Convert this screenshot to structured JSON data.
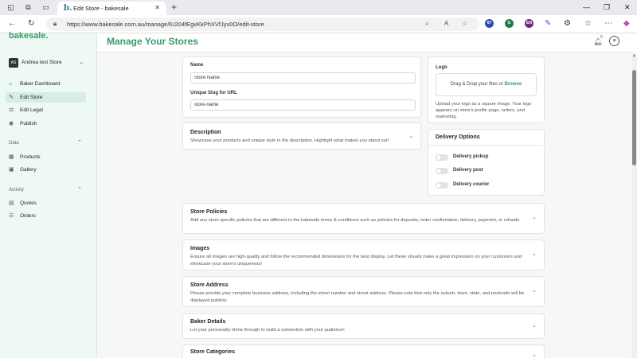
{
  "browser": {
    "tab_title": "Edit Store - bakesale",
    "tab_favicon": "b.",
    "url": "https://www.bakesale.com.au/manage/lU204fEgvKkPhXVfJyv0O/edit-store",
    "extensions": [
      "67",
      "G",
      "EN"
    ]
  },
  "sidebar": {
    "logo": "bakesale.",
    "store_avatar": "AS",
    "store_name": "Andrea test Store",
    "items": [
      {
        "label": "Baker Dashboard",
        "icon": "home-icon"
      },
      {
        "label": "Edit Store",
        "icon": "edit-icon"
      },
      {
        "label": "Edit Legal",
        "icon": "legal-icon"
      },
      {
        "label": "Publish",
        "icon": "eye-icon"
      }
    ],
    "data_section": "Data",
    "data_items": [
      {
        "label": "Products",
        "icon": "box-icon"
      },
      {
        "label": "Gallery",
        "icon": "image-icon"
      }
    ],
    "activity_section": "Activity",
    "activity_items": [
      {
        "label": "Quotes",
        "icon": "document-icon"
      },
      {
        "label": "Orders",
        "icon": "list-icon"
      }
    ]
  },
  "header": {
    "title": "Manage Your Stores",
    "bell_badge": "0"
  },
  "form": {
    "name_label": "Name",
    "name_value": "Store Name",
    "slug_label": "Unique Slug for URL",
    "slug_value": "store-name",
    "description_title": "Description",
    "description_text": "Showcase your products and unique style in the description. Highlight what makes you stand out!"
  },
  "logo": {
    "title": "Logo",
    "dropzone_text": "Drag & Drop your files or ",
    "dropzone_link": "Browse",
    "help": "Upload your logo as a square image. Your logo appears on store's profile page, orders, and marketing."
  },
  "delivery": {
    "title": "Delivery Options",
    "options": [
      {
        "label": "Delivery pickup",
        "enabled": false
      },
      {
        "label": "Delivery post",
        "enabled": false
      },
      {
        "label": "Delivery courier",
        "enabled": false
      }
    ]
  },
  "sections": [
    {
      "title": "Store Policies",
      "desc": "Add any store specific policies that are different to the bakesale terms & conditions such as policies for deposits, order confirmation, delivery, payment, or refunds."
    },
    {
      "title": "Images",
      "desc": "Ensure all images are high-quality and follow the recommended dimensions for the best display. Let these visuals make a great impression on your customers and showcase your store's uniqueness!"
    },
    {
      "title": "Store Address",
      "desc": "Please provide your complete business address, including the street number and street address. Please note that only the suburb, town, state, and postcode will be displayed publicly."
    },
    {
      "title": "Baker Details",
      "desc": "Let your personality shine through to build a connection with your audience!"
    },
    {
      "title": "Store Categories",
      "desc": ""
    }
  ]
}
